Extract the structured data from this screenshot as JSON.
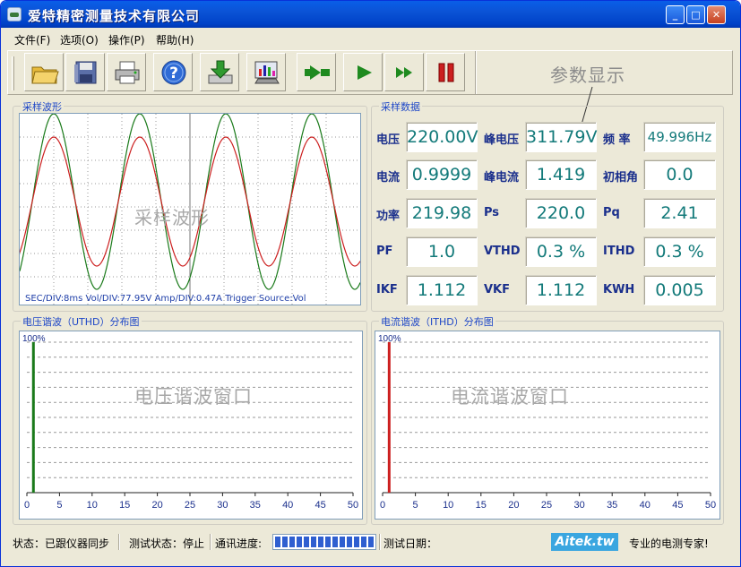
{
  "window": {
    "title": "爱特精密测量技术有限公司"
  },
  "menu": [
    {
      "label": "文件(F)"
    },
    {
      "label": "选项(O)"
    },
    {
      "label": "操作(P)"
    },
    {
      "label": "帮助(H)"
    }
  ],
  "toolbar": {
    "buttons": [
      "open-folder-icon",
      "save-disk-icon",
      "print-icon",
      "help-icon",
      "download-icon",
      "chart-monitor-icon",
      "step-play-icon",
      "play-icon",
      "fast-forward-icon",
      "pause-icon"
    ],
    "param_label": "参数显示"
  },
  "waveform": {
    "group_title": "采样波形",
    "watermark": "采样波形",
    "status": "SEC/DIV:8ms   Vol/DIV:77.95V   Amp/DIV:0.47A   Trigger Source:Vol",
    "colors": {
      "voltage": "#1a7a1a",
      "current": "#cc1f1f",
      "grid": "#9a9a9a"
    }
  },
  "sample_data": {
    "group_title": "采样数据",
    "rows": [
      [
        {
          "label": "电压",
          "value": "220.00V"
        },
        {
          "label": "峰电压",
          "value": "311.79V"
        },
        {
          "label": "频  率",
          "value": "49.996Hz"
        }
      ],
      [
        {
          "label": "电流",
          "value": "0.9999"
        },
        {
          "label": "峰电流",
          "value": "1.419"
        },
        {
          "label": "初相角",
          "value": "0.0"
        }
      ],
      [
        {
          "label": "功率",
          "value": "219.98"
        },
        {
          "label": "Ps",
          "value": "220.0"
        },
        {
          "label": "Pq",
          "value": "2.41"
        }
      ],
      [
        {
          "label": "PF",
          "value": "1.0"
        },
        {
          "label": "VTHD",
          "value": "0.3 %"
        },
        {
          "label": "ITHD",
          "value": "0.3 %"
        }
      ],
      [
        {
          "label": "IKF",
          "value": "1.112"
        },
        {
          "label": "VKF",
          "value": "1.112"
        },
        {
          "label": "KWH",
          "value": "0.005"
        }
      ]
    ]
  },
  "uthd": {
    "group_title": "电压谐波（UTHD）分布图",
    "watermark": "电压谐波窗口",
    "top_label": "100%",
    "x_ticks": [
      "0",
      "5",
      "10",
      "15",
      "20",
      "25",
      "30",
      "35",
      "40",
      "45",
      "50"
    ],
    "bar_color": "#1a7a1a",
    "fundamental_percent": 100
  },
  "ithd": {
    "group_title": "电流谐波（ITHD）分布图",
    "watermark": "电流谐波窗口",
    "top_label": "100%",
    "x_ticks": [
      "0",
      "5",
      "10",
      "15",
      "20",
      "25",
      "30",
      "35",
      "40",
      "45",
      "50"
    ],
    "bar_color": "#cc1f1f",
    "fundamental_percent": 100
  },
  "status_bar": {
    "state": "状态：已跟仪器同步",
    "test_state": "测试状态：停止",
    "comm_progress": "通讯进度:",
    "progress_percent": 100,
    "test_date": "测试日期：",
    "brand": "Aitek.tw",
    "slogan": "专业的电测专家!"
  }
}
